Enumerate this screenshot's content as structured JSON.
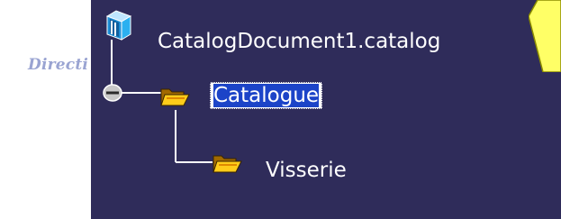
{
  "background": {
    "partial_label": "Directi"
  },
  "tree": {
    "root": {
      "label": "CatalogDocument1.catalog",
      "icon": "catalog-book-icon"
    },
    "children": [
      {
        "label": "Catalogue",
        "icon": "open-folder-icon",
        "selected": true,
        "expanded": true,
        "children": [
          {
            "label": "Visserie",
            "icon": "open-folder-icon"
          }
        ]
      }
    ]
  },
  "colors": {
    "panel_background": "#2f2c5a",
    "selection": "#1c44c8",
    "text": "#ffffff",
    "callout": "#ffff66"
  }
}
